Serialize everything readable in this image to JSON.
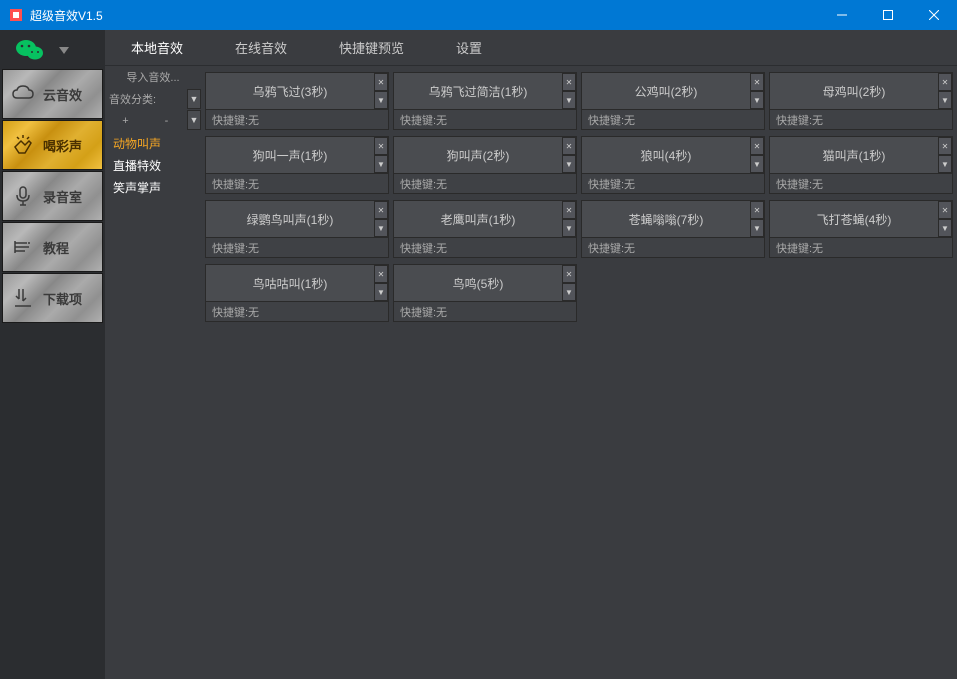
{
  "window": {
    "title": "超级音效V1.5"
  },
  "sidebar": {
    "items": [
      {
        "label": "云音效",
        "icon": "cloud",
        "style": "steel"
      },
      {
        "label": "喝彩声",
        "icon": "clap",
        "style": "gold"
      },
      {
        "label": "录音室",
        "icon": "mic",
        "style": "steel"
      },
      {
        "label": "教程",
        "icon": "tutorial",
        "style": "steel"
      },
      {
        "label": "下载项",
        "icon": "download",
        "style": "steel"
      }
    ]
  },
  "tabs": [
    {
      "label": "本地音效",
      "active": true
    },
    {
      "label": "在线音效",
      "active": false
    },
    {
      "label": "快捷键预览",
      "active": false
    },
    {
      "label": "设置",
      "active": false
    }
  ],
  "category_panel": {
    "import_label": "导入音效...",
    "classification_label": "音效分类:",
    "symbols": [
      "+",
      "-"
    ],
    "items": [
      {
        "label": "动物叫声",
        "active": true
      },
      {
        "label": "直播特效",
        "active": false
      },
      {
        "label": "笑声掌声",
        "active": false
      }
    ]
  },
  "hotkey_prefix": "快捷键:",
  "hotkey_none": "无",
  "sounds": [
    {
      "name": "乌鸦飞过(3秒)",
      "hotkey": "无"
    },
    {
      "name": "乌鸦飞过简洁(1秒)",
      "hotkey": "无"
    },
    {
      "name": "公鸡叫(2秒)",
      "hotkey": "无"
    },
    {
      "name": "母鸡叫(2秒)",
      "hotkey": "无"
    },
    {
      "name": "狗叫一声(1秒)",
      "hotkey": "无"
    },
    {
      "name": "狗叫声(2秒)",
      "hotkey": "无"
    },
    {
      "name": "狼叫(4秒)",
      "hotkey": "无"
    },
    {
      "name": "猫叫声(1秒)",
      "hotkey": "无"
    },
    {
      "name": "绿鹦鸟叫声(1秒)",
      "hotkey": "无"
    },
    {
      "name": "老鹰叫声(1秒)",
      "hotkey": "无"
    },
    {
      "name": "苍蝇嗡嗡(7秒)",
      "hotkey": "无"
    },
    {
      "name": "飞打苍蝇(4秒)",
      "hotkey": "无"
    },
    {
      "name": "鸟咕咕叫(1秒)",
      "hotkey": "无"
    },
    {
      "name": "鸟鸣(5秒)",
      "hotkey": "无"
    }
  ]
}
